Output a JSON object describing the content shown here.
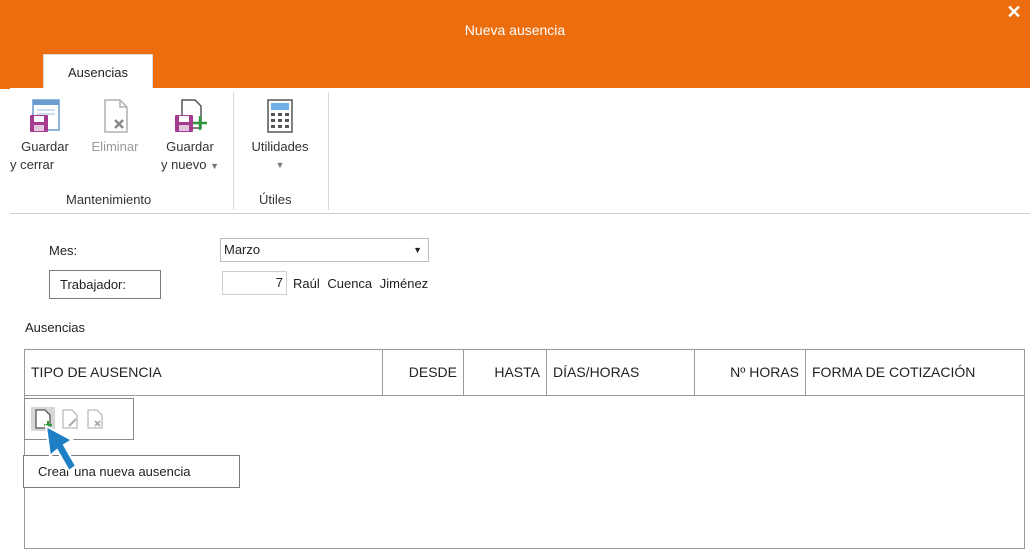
{
  "window": {
    "title": "Nueva ausencia"
  },
  "ribbon": {
    "tab": "Ausencias",
    "buttons": {
      "guardar_cerrar": {
        "line1": "Guardar",
        "line2": "y cerrar"
      },
      "eliminar": {
        "line1": "Eliminar"
      },
      "guardar_nuevo": {
        "line1": "Guardar",
        "line2": "y nuevo"
      },
      "utilidades": {
        "line1": "Utilidades"
      }
    },
    "groups": {
      "mantenimiento": "Mantenimiento",
      "utiles": "Útiles"
    }
  },
  "form": {
    "mes_label": "Mes:",
    "mes_value": "Marzo",
    "trabajador_label": "Trabajador:",
    "trabajador_code": "7",
    "trabajador_name": "Raúl Cuenca Jiménez"
  },
  "absences": {
    "section_title": "Ausencias",
    "columns": [
      "TIPO DE AUSENCIA",
      "DESDE",
      "HASTA",
      "DÍAS/HORAS",
      "Nº HORAS",
      "FORMA DE COTIZACIÓN"
    ],
    "tooltip": "Crear una nueva ausencia"
  },
  "colors": {
    "accent": "#ec6d0e",
    "cursor": "#1f7fc4"
  }
}
